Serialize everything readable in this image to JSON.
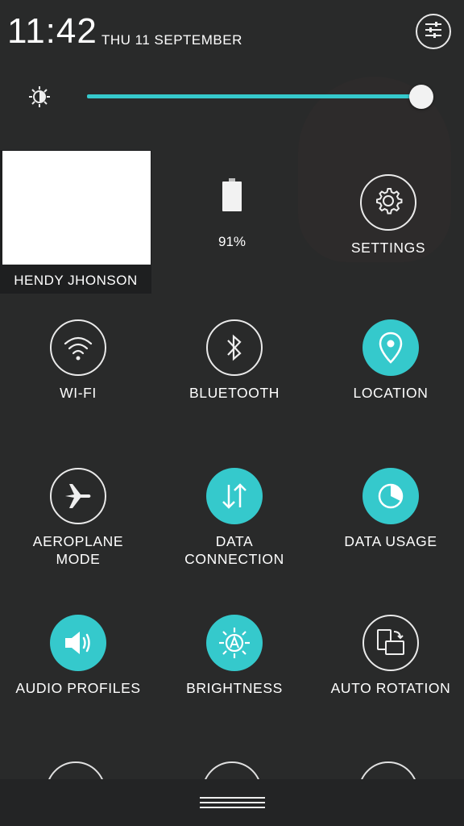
{
  "status": {
    "time": "11:42",
    "date": "THU 11 SEPTEMBER"
  },
  "profile": {
    "name": "HENDY JHONSON"
  },
  "battery": {
    "percent": "91%",
    "level": 0.91
  },
  "brightness": {
    "level": 0.95
  },
  "settings": {
    "label": "SETTINGS"
  },
  "tiles": [
    {
      "label": "WI-FI",
      "state": "off",
      "icon": "wifi-icon"
    },
    {
      "label": "BLUETOOTH",
      "state": "off",
      "icon": "bluetooth-icon"
    },
    {
      "label": "LOCATION",
      "state": "on",
      "icon": "location-pin-icon"
    },
    {
      "label": "AEROPLANE\nMODE",
      "state": "off",
      "icon": "airplane-icon"
    },
    {
      "label": "DATA\nCONNECTION",
      "state": "on",
      "icon": "data-arrows-icon"
    },
    {
      "label": "DATA USAGE",
      "state": "on",
      "icon": "pie-chart-icon"
    },
    {
      "label": "AUDIO PROFILES",
      "state": "on",
      "icon": "speaker-icon"
    },
    {
      "label": "BRIGHTNESS",
      "state": "on",
      "icon": "auto-brightness-icon"
    },
    {
      "label": "AUTO ROTATION",
      "state": "off",
      "icon": "rotate-screen-icon"
    }
  ],
  "colors": {
    "accent": "#35c9cc",
    "background": "#2a2b2c"
  }
}
